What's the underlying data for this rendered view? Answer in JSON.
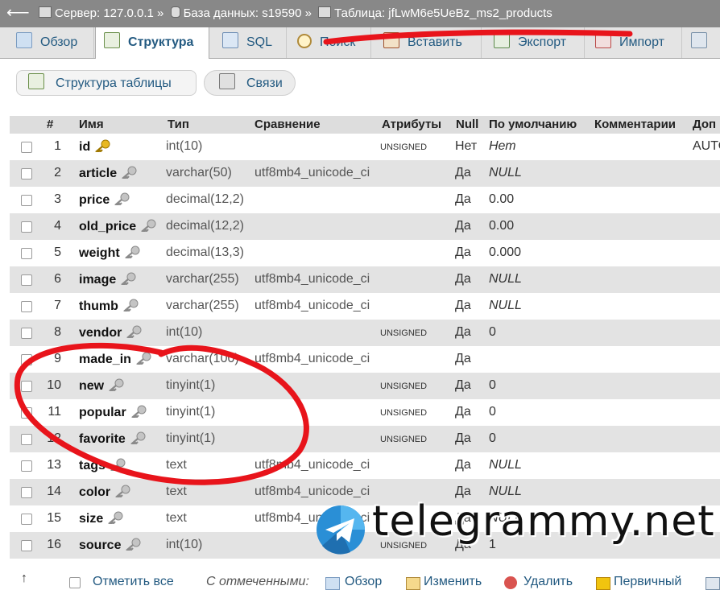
{
  "topbar": {
    "back": "⟵",
    "server_label": "Сервер: 127.0.0.1 »",
    "db_label": "База данных: s19590 »",
    "table_label": "Таблица: jfLwM6e5UeBz_ms2_products"
  },
  "tabs": [
    {
      "label": "Обзор",
      "icon": "browse-icon"
    },
    {
      "label": "Структура",
      "icon": "structure-icon"
    },
    {
      "label": "SQL",
      "icon": "sql-icon"
    },
    {
      "label": "Поиск",
      "icon": "search-icon"
    },
    {
      "label": "Вставить",
      "icon": "insert-icon"
    },
    {
      "label": "Экспорт",
      "icon": "export-icon"
    },
    {
      "label": "Импорт",
      "icon": "import-icon"
    }
  ],
  "subnav": {
    "table_structure": "Структура таблицы",
    "relations": "Связи"
  },
  "columns": {
    "num": "#",
    "name": "Имя",
    "type": "Тип",
    "collation": "Сравнение",
    "attributes": "Атрибуты",
    "null": "Null",
    "default": "По умолчанию",
    "comments": "Комментарии",
    "extra": "Доп"
  },
  "rows": [
    {
      "num": "1",
      "name": "id",
      "type": "int(10)",
      "collation": "",
      "attr": "UNSIGNED",
      "null": "Нет",
      "default": "Нет",
      "extra": "AUTO"
    },
    {
      "num": "2",
      "name": "article",
      "type": "varchar(50)",
      "collation": "utf8mb4_unicode_ci",
      "attr": "",
      "null": "Да",
      "default": "NULL",
      "extra": ""
    },
    {
      "num": "3",
      "name": "price",
      "type": "decimal(12,2)",
      "collation": "",
      "attr": "",
      "null": "Да",
      "default": "0.00",
      "extra": ""
    },
    {
      "num": "4",
      "name": "old_price",
      "type": "decimal(12,2)",
      "collation": "",
      "attr": "",
      "null": "Да",
      "default": "0.00",
      "extra": ""
    },
    {
      "num": "5",
      "name": "weight",
      "type": "decimal(13,3)",
      "collation": "",
      "attr": "",
      "null": "Да",
      "default": "0.000",
      "extra": ""
    },
    {
      "num": "6",
      "name": "image",
      "type": "varchar(255)",
      "collation": "utf8mb4_unicode_ci",
      "attr": "",
      "null": "Да",
      "default": "NULL",
      "extra": ""
    },
    {
      "num": "7",
      "name": "thumb",
      "type": "varchar(255)",
      "collation": "utf8mb4_unicode_ci",
      "attr": "",
      "null": "Да",
      "default": "NULL",
      "extra": ""
    },
    {
      "num": "8",
      "name": "vendor",
      "type": "int(10)",
      "collation": "",
      "attr": "UNSIGNED",
      "null": "Да",
      "default": "0",
      "extra": ""
    },
    {
      "num": "9",
      "name": "made_in",
      "type": "varchar(100)",
      "collation": "utf8mb4_unicode_ci",
      "attr": "",
      "null": "Да",
      "default": "",
      "extra": ""
    },
    {
      "num": "10",
      "name": "new",
      "type": "tinyint(1)",
      "collation": "",
      "attr": "UNSIGNED",
      "null": "Да",
      "default": "0",
      "extra": ""
    },
    {
      "num": "11",
      "name": "popular",
      "type": "tinyint(1)",
      "collation": "",
      "attr": "UNSIGNED",
      "null": "Да",
      "default": "0",
      "extra": ""
    },
    {
      "num": "12",
      "name": "favorite",
      "type": "tinyint(1)",
      "collation": "",
      "attr": "UNSIGNED",
      "null": "Да",
      "default": "0",
      "extra": ""
    },
    {
      "num": "13",
      "name": "tags",
      "type": "text",
      "collation": "utf8mb4_unicode_ci",
      "attr": "",
      "null": "Да",
      "default": "NULL",
      "extra": ""
    },
    {
      "num": "14",
      "name": "color",
      "type": "text",
      "collation": "utf8mb4_unicode_ci",
      "attr": "",
      "null": "Да",
      "default": "NULL",
      "extra": ""
    },
    {
      "num": "15",
      "name": "size",
      "type": "text",
      "collation": "utf8mb4_unicode_ci",
      "attr": "",
      "null": "Да",
      "default": "NULL",
      "extra": ""
    },
    {
      "num": "16",
      "name": "source",
      "type": "int(10)",
      "collation": "",
      "attr": "UNSIGNED",
      "null": "Да",
      "default": "1",
      "extra": ""
    }
  ],
  "bottom": {
    "arrow": "↑",
    "check_all": "Отметить все",
    "with_selected": "С отмеченными:",
    "browse": "Обзор",
    "change": "Изменить",
    "drop": "Удалить",
    "primary": "Первичный"
  },
  "watermark": "telegrammy.net",
  "colors": {
    "link": "#235a81",
    "header_bg": "#dddddd",
    "row_alt": "#e3e3e3",
    "scribble": "#e8141b"
  }
}
